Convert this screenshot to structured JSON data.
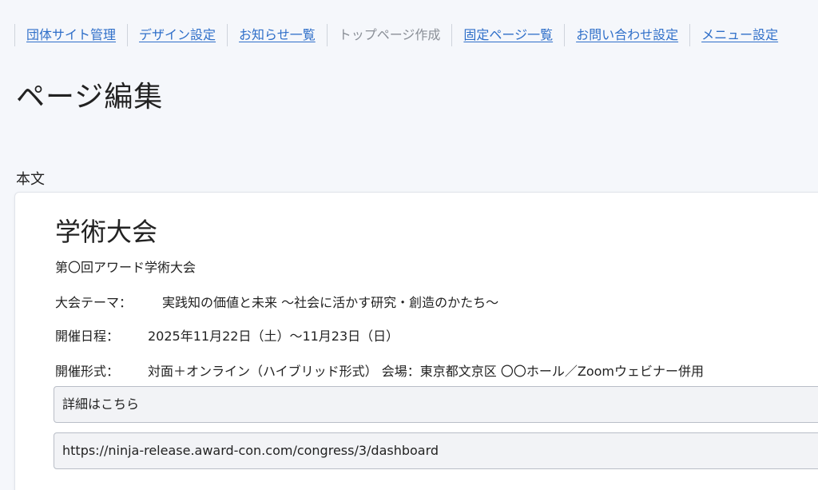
{
  "nav": {
    "items": [
      {
        "label": "団体サイト管理",
        "link": true
      },
      {
        "label": "デザイン設定",
        "link": true
      },
      {
        "label": "お知らせ一覧",
        "link": true
      },
      {
        "label": "トップページ作成",
        "link": false
      },
      {
        "label": "固定ページ一覧",
        "link": true
      },
      {
        "label": "お問い合わせ設定",
        "link": true
      },
      {
        "label": "メニュー設定",
        "link": true
      }
    ]
  },
  "page": {
    "title": "ページ編集",
    "section_label": "本文"
  },
  "editor": {
    "heading": "学術大会",
    "subtitle": "第〇回アワード学術大会",
    "theme_label": "大会テーマ：",
    "theme_value": "実践知の価値と未来 〜社会に活かす研究・創造のかたち〜",
    "date_label": "開催日程：",
    "date_value": "2025年11月22日（土）〜11月23日（日）",
    "format_label": "開催形式：",
    "format_value": "対面＋オンライン（ハイブリッド形式） 会場：東京都文京区 〇〇ホール／Zoomウェビナー併用",
    "button_text": "詳細はこちら",
    "url_text": "https://ninja-release.award-con.com/congress/3/dashboard"
  },
  "colors": {
    "link": "#2f6fc9",
    "current_nav": "#8a8f97",
    "background": "#f5f7fb"
  }
}
